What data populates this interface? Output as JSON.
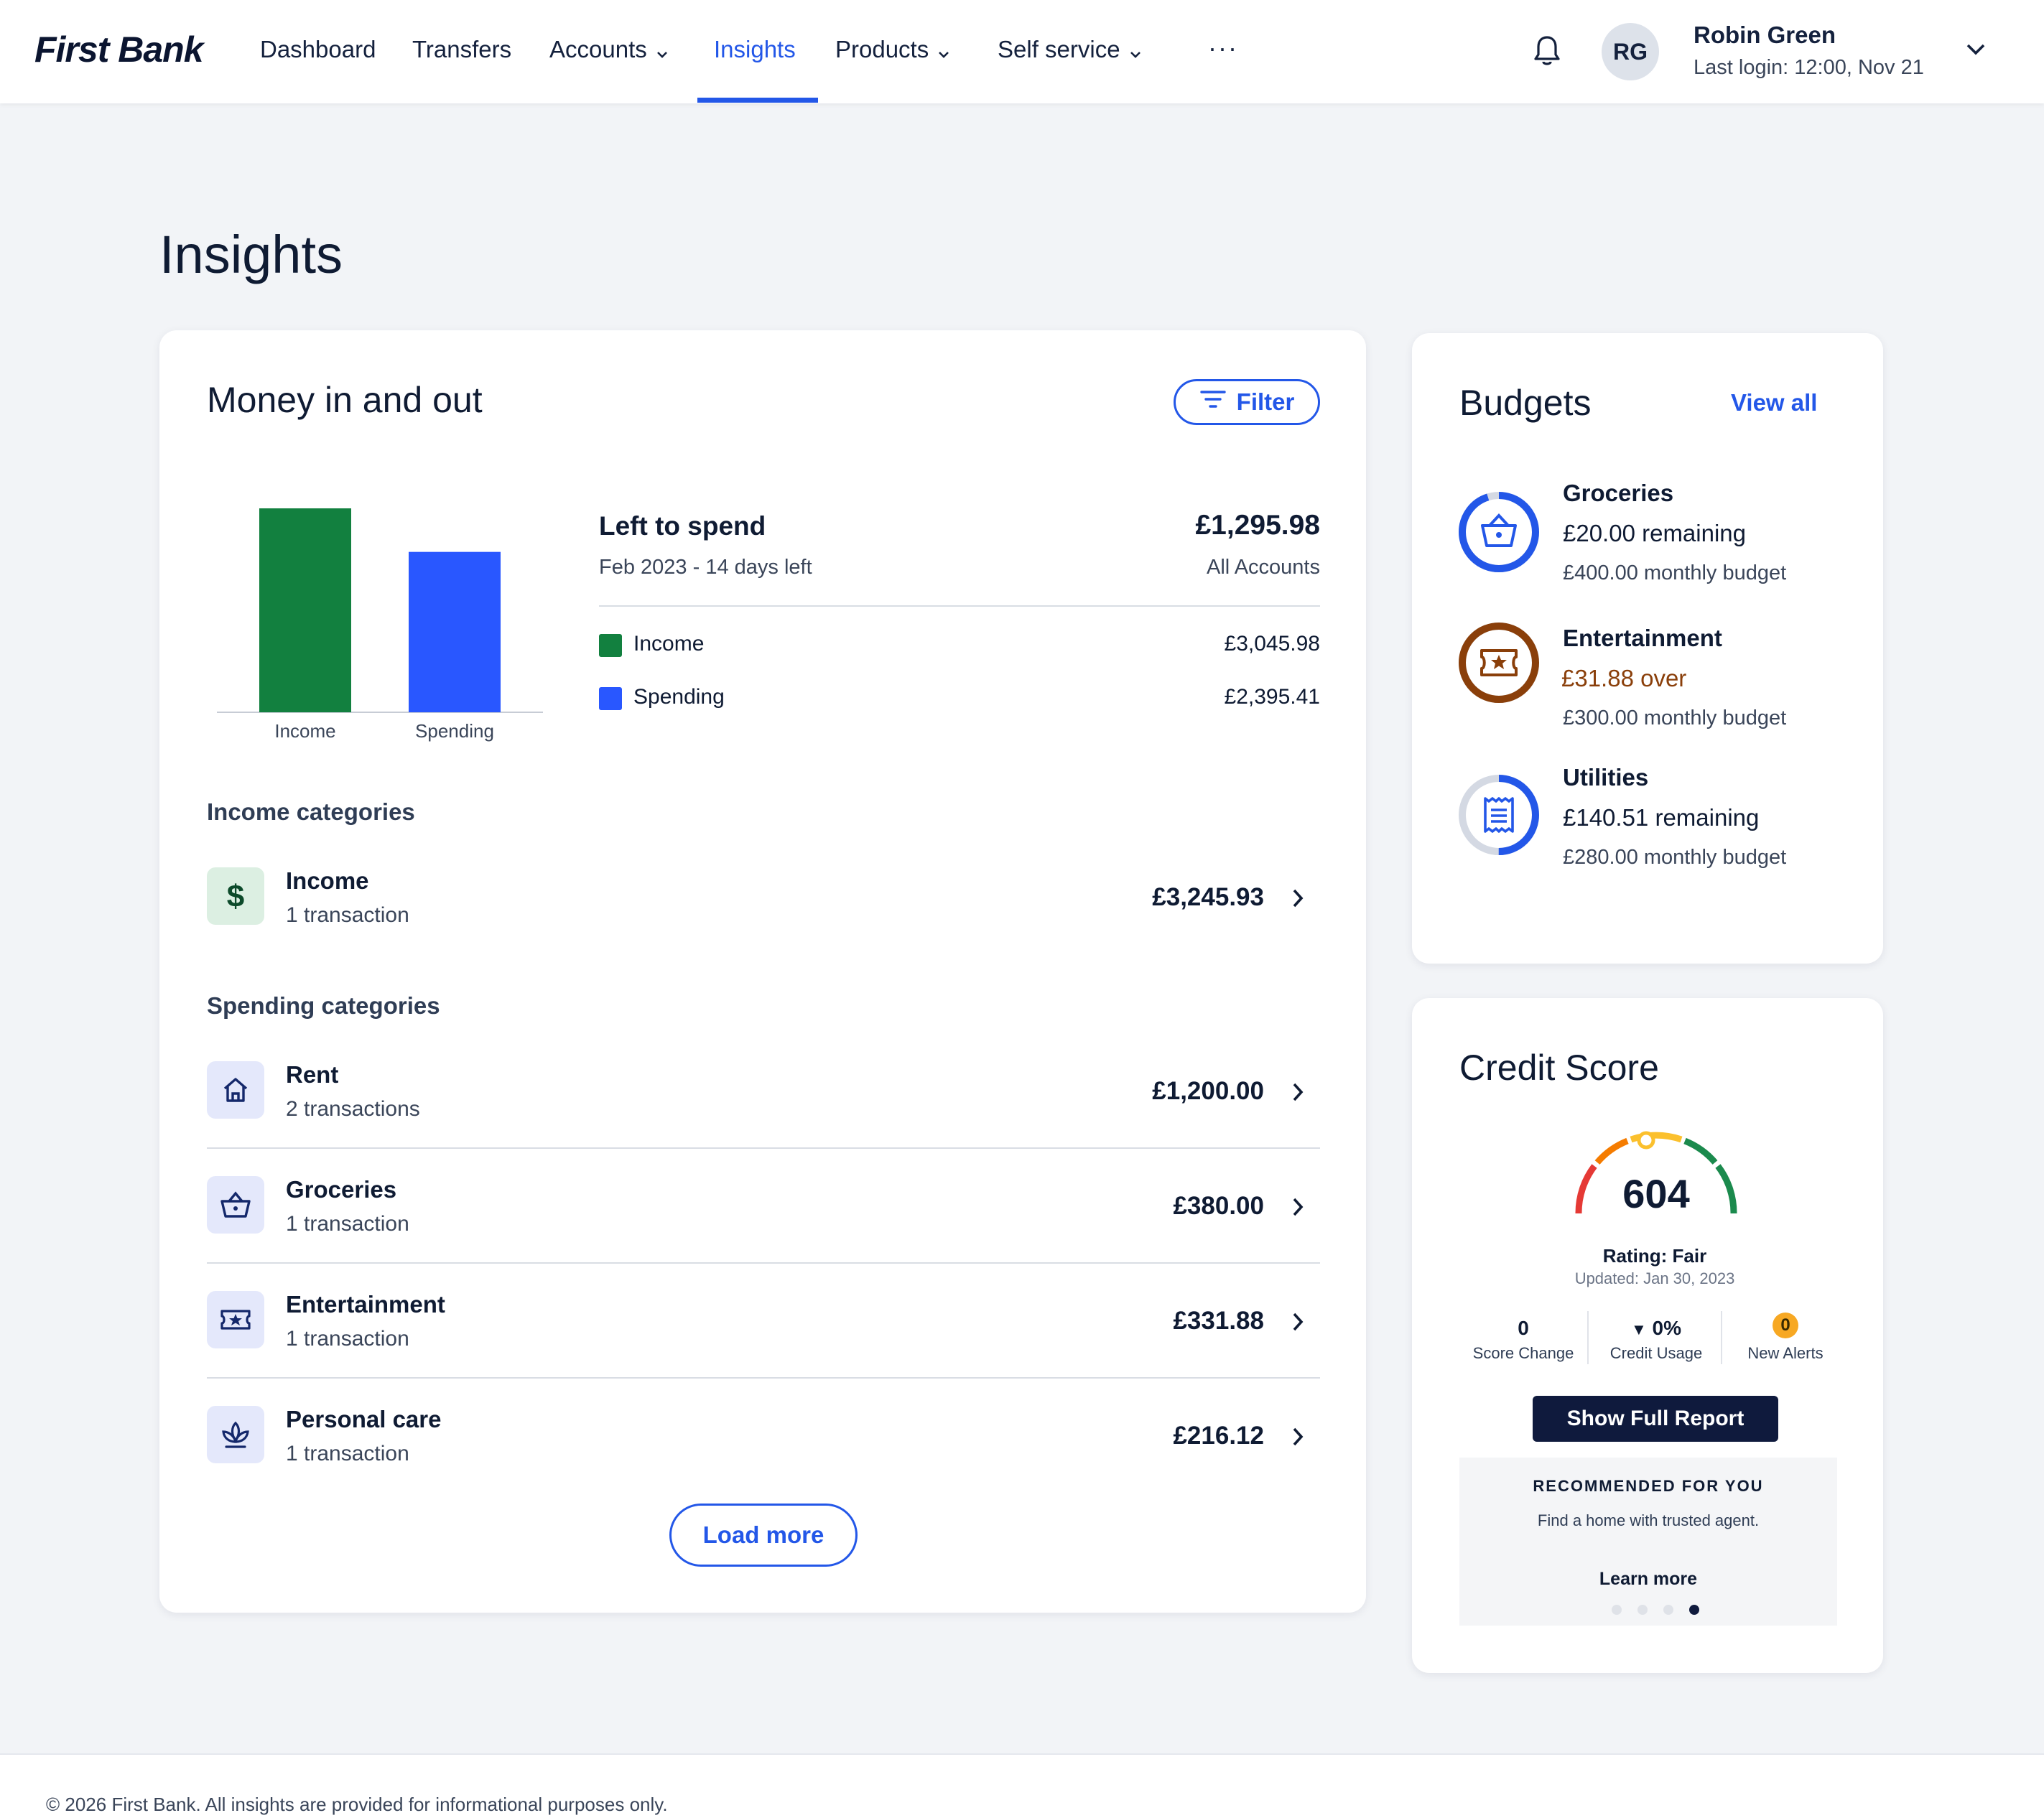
{
  "brand": {
    "name": "First Bank"
  },
  "nav": {
    "items": [
      {
        "label": "Dashboard"
      },
      {
        "label": "Transfers"
      },
      {
        "label": "Accounts"
      },
      {
        "label": "Insights"
      },
      {
        "label": "Products"
      },
      {
        "label": "Self service"
      }
    ],
    "active": "Insights",
    "more_label": "···"
  },
  "user": {
    "initials": "RG",
    "name": "Robin Green",
    "last_login": "Last login: 12:00, Nov 21"
  },
  "page": {
    "title": "Insights"
  },
  "money": {
    "title": "Money in and out",
    "filter_label": "Filter",
    "left_to_spend_label": "Left to spend",
    "left_to_spend_amount": "£1,295.98",
    "period": "Feb 2023 - 14 days left",
    "scope": "All Accounts",
    "legend": [
      {
        "label": "Income",
        "value": "£3,045.98",
        "color": "#12803f"
      },
      {
        "label": "Spending",
        "value": "£2,395.41",
        "color": "#2957ff"
      }
    ],
    "income_categories_title": "Income categories",
    "income_categories": [
      {
        "name": "Income",
        "sub": "1 transaction",
        "amount": "£3,245.93",
        "icon": "dollar-icon"
      }
    ],
    "spending_categories_title": "Spending categories",
    "spending_categories": [
      {
        "name": "Rent",
        "sub": "2 transactions",
        "amount": "£1,200.00",
        "icon": "home-icon"
      },
      {
        "name": "Groceries",
        "sub": "1 transaction",
        "amount": "£380.00",
        "icon": "basket-icon"
      },
      {
        "name": "Entertainment",
        "sub": "1 transaction",
        "amount": "£331.88",
        "icon": "ticket-icon"
      },
      {
        "name": "Personal care",
        "sub": "1 transaction",
        "amount": "£216.12",
        "icon": "lotus-icon"
      }
    ],
    "load_more_label": "Load more"
  },
  "chart_data": {
    "type": "bar",
    "categories": [
      "Income",
      "Spending"
    ],
    "values": [
      3045.98,
      2395.41
    ],
    "colors": [
      "#12803f",
      "#2957ff"
    ],
    "ylim": [
      0,
      3045.98
    ],
    "grid": false
  },
  "budgets": {
    "title": "Budgets",
    "view_all_label": "View all",
    "items": [
      {
        "name": "Groceries",
        "status": "£20.00 remaining",
        "limit": "£400.00 monthly budget",
        "progress": 0.95,
        "color": "#2357e8",
        "status_color": "#0f1b33",
        "icon": "basket-icon"
      },
      {
        "name": "Entertainment",
        "status": "£31.88 over",
        "limit": "£300.00 monthly budget",
        "progress": 1.0,
        "color": "#8a3f0a",
        "status_color": "#8a3f0a",
        "icon": "ticket-icon"
      },
      {
        "name": "Utilities",
        "status": "£140.51 remaining",
        "limit": "£280.00 monthly budget",
        "progress": 0.5,
        "color": "#2357e8",
        "status_color": "#0f1b33",
        "icon": "receipt-icon"
      }
    ]
  },
  "credit": {
    "title": "Credit Score",
    "score": "604",
    "rating": "Rating: Fair",
    "updated": "Updated: Jan 30, 2023",
    "stats": [
      {
        "value": "0",
        "label": "Score Change"
      },
      {
        "value": "0%",
        "label": "Credit Usage"
      },
      {
        "value": "0",
        "label": "New Alerts"
      }
    ],
    "show_report_label": "Show Full Report",
    "reco_heading": "RECOMMENDED FOR YOU",
    "reco_text": "Find a home with trusted agent.",
    "learn_more_label": "Learn more",
    "carousel_active": 4
  },
  "footer": {
    "text": "© 2026 First Bank. All insights are provided for informational purposes only."
  }
}
